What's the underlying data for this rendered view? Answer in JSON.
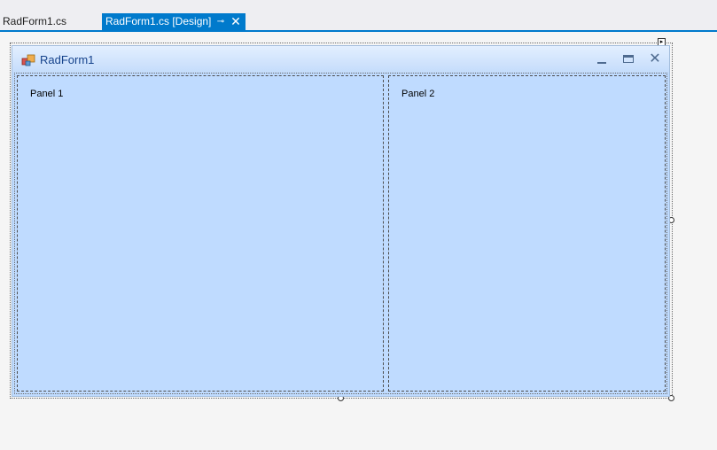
{
  "tabs": [
    {
      "label": "RadForm1.cs",
      "active": false
    },
    {
      "label": "RadForm1.cs [Design]",
      "active": true,
      "pin_glyph": "⊸",
      "close_glyph": "✕"
    }
  ],
  "form": {
    "title": "RadForm1",
    "icon": "form-app-icon",
    "buttons": {
      "minimize": "minimize-icon",
      "maximize": "maximize-icon",
      "close_glyph": "✕"
    }
  },
  "split": {
    "panels": [
      {
        "label": "Panel 1"
      },
      {
        "label": "Panel 2"
      }
    ]
  },
  "designer": {
    "smart_tag_glyph": "▸"
  },
  "colors": {
    "accent": "#007acc",
    "panel_bg": "#bfdbff",
    "title_text": "#15428b"
  }
}
